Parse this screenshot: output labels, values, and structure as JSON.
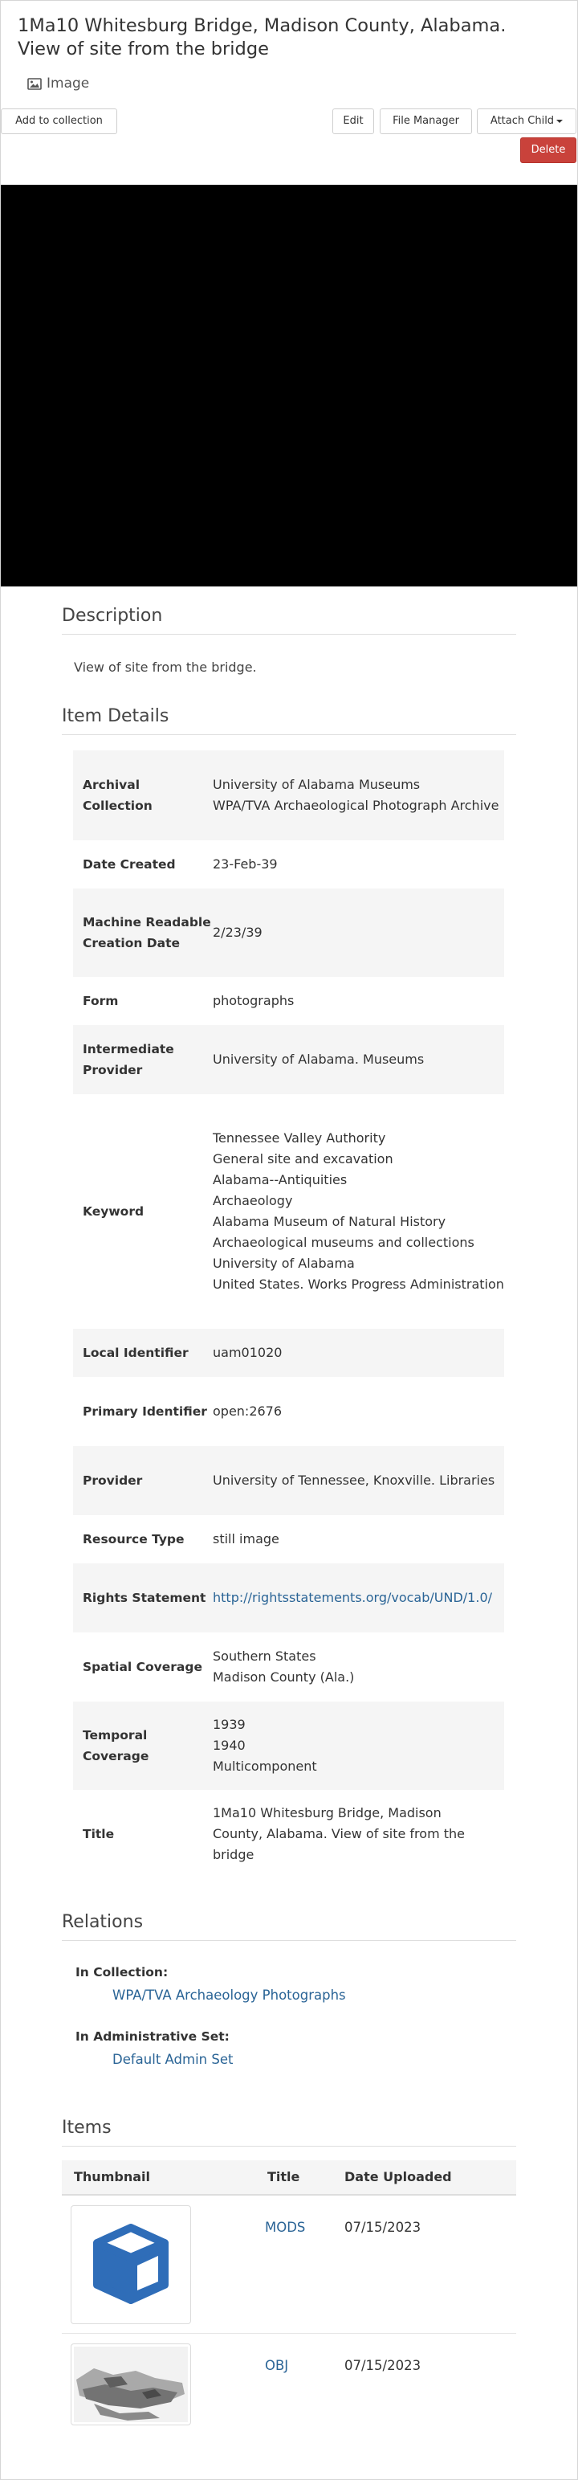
{
  "work": {
    "title": "1Ma10 Whitesburg Bridge, Madison County, Alabama. View of site from the bridge",
    "type_label": "Image"
  },
  "toolbar": {
    "add_to_collection": "Add to collection",
    "edit": "Edit",
    "file_manager": "File Manager",
    "attach_child": "Attach Child",
    "delete": "Delete"
  },
  "description": {
    "heading": "Description",
    "text": "View of site from the bridge."
  },
  "item_details": {
    "heading": "Item Details",
    "rows": [
      {
        "label": "Archival Collection",
        "values": [
          "University of Alabama Museums",
          "WPA/TVA Archaeological Photograph Archive"
        ]
      },
      {
        "label": "Date Created",
        "values": [
          "23-Feb-39"
        ]
      },
      {
        "label": "Machine Readable Creation Date",
        "values": [
          "2/23/39"
        ]
      },
      {
        "label": "Form",
        "values": [
          "photographs"
        ]
      },
      {
        "label": "Intermediate Provider",
        "values": [
          "University of Alabama. Museums"
        ]
      },
      {
        "label": "Keyword",
        "values": [
          "Tennessee Valley Authority",
          "General site and excavation",
          "Alabama--Antiquities",
          "Archaeology",
          "Alabama Museum of Natural History",
          "Archaeological museums and collections",
          "University of Alabama",
          "United States. Works Progress Administration"
        ]
      },
      {
        "label": "Local Identifier",
        "values": [
          "uam01020"
        ]
      },
      {
        "label": "Primary Identifier",
        "values": [
          "open:2676"
        ]
      },
      {
        "label": "Provider",
        "values": [
          "University of Tennessee, Knoxville. Libraries"
        ]
      },
      {
        "label": "Resource Type",
        "values": [
          "still image"
        ]
      },
      {
        "label": "Rights Statement",
        "values": [
          "http://rightsstatements.org/vocab/UND/1.0/"
        ]
      },
      {
        "label": "Spatial Coverage",
        "values": [
          "Southern States",
          "Madison County (Ala.)"
        ]
      },
      {
        "label": "Temporal Coverage",
        "values": [
          "1939",
          "1940",
          "Multicomponent"
        ]
      },
      {
        "label": "Title",
        "values": [
          "1Ma10 Whitesburg Bridge, Madison County, Alabama. View of site from the bridge"
        ]
      }
    ]
  },
  "relations": {
    "heading": "Relations",
    "in_collection_label": "In Collection:",
    "in_collection_link": "WPA/TVA Archaeology Photographs",
    "in_admin_set_label": "In Administrative Set:",
    "in_admin_set_link": "Default Admin Set"
  },
  "items": {
    "heading": "Items",
    "columns": [
      "Thumbnail",
      "Title",
      "Date Uploaded"
    ],
    "rows": [
      {
        "title": "MODS",
        "date_uploaded": "07/15/2023",
        "thumbnail_icon": "cube-icon"
      },
      {
        "title": "OBJ",
        "date_uploaded": "07/15/2023",
        "thumbnail_icon": "photo-thumbnail"
      }
    ]
  },
  "colors": {
    "link": "#2a6496",
    "danger": "#c9423b",
    "cube": "#2f6db8"
  }
}
